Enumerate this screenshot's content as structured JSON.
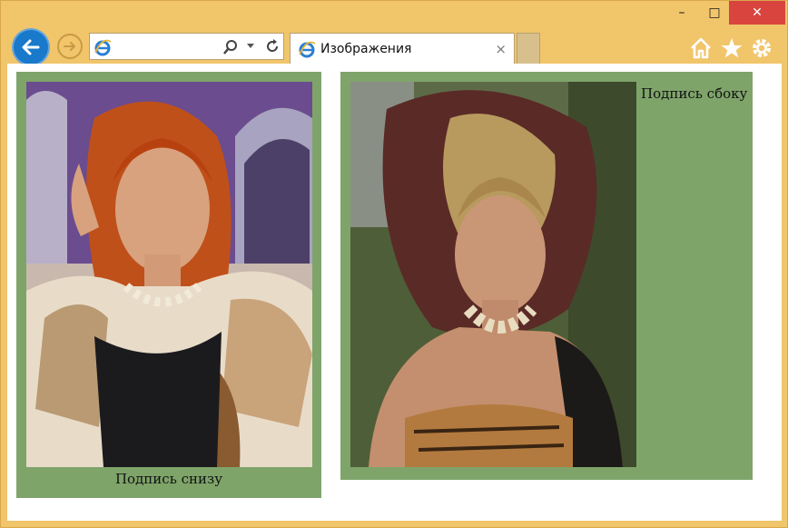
{
  "tab": {
    "title": "Изображения",
    "close": "×"
  },
  "window_controls": {
    "minimize": "–",
    "maximize": "□",
    "close": "✕"
  },
  "figures": {
    "first": {
      "caption": "Подпись снизу"
    },
    "second": {
      "caption": "Подпись сбоку"
    }
  },
  "colors": {
    "frame": "#f1c56a",
    "figure_bg": "#7fa46a",
    "back_button": "#1979ca",
    "close_button": "#d9443e"
  },
  "icons": [
    "back-arrow-icon",
    "forward-arrow-icon",
    "ie-logo-icon",
    "search-icon",
    "dropdown-icon",
    "refresh-icon",
    "close-icon",
    "home-icon",
    "star-icon",
    "gear-icon"
  ]
}
